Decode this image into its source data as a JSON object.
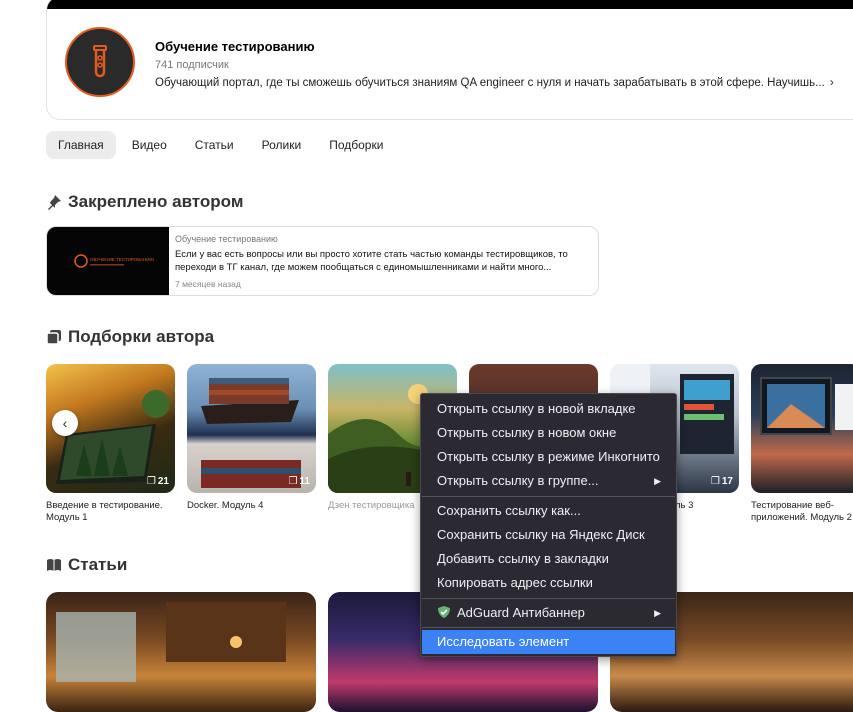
{
  "channel": {
    "title": "Обучение тестированию",
    "subscribers": "741 подписчик",
    "description": "Обучающий портал, где ты сможешь обучиться знаниям QA engineer с нуля и начать зарабатывать в этой сфере. Научишь...",
    "more_icon": "chevron-right-icon"
  },
  "tabs": [
    "Главная",
    "Видео",
    "Статьи",
    "Ролики",
    "Подборки"
  ],
  "pinned": {
    "section_title": "Закреплено автором",
    "author": "Обучение тестированию",
    "text": "Если у вас есть вопросы или вы просто хотите стать частью команды тестировщиков, то переходи в ТГ канал, где можем пообщаться с единомышленниками и найти много...",
    "time": "7 месяцев назад",
    "thumb_caption": "ОБУЧЕНИЕ ТЕСТИРОВАНИЮ"
  },
  "collections": {
    "section_title": "Подборки автора",
    "items": [
      {
        "label": "Введение в тестирование. Модуль 1",
        "count": "21"
      },
      {
        "label": "Docker. Модуль 4",
        "count": "11"
      },
      {
        "label": "Дзен тестировщика",
        "count": ""
      },
      {
        "label": "ль 3",
        "count": "17"
      },
      {
        "label": "",
        "count": "17"
      },
      {
        "label": "Тестирование веб-приложений. Модуль 2",
        "count": ""
      }
    ]
  },
  "articles": {
    "section_title": "Статьи"
  },
  "context_menu": {
    "items": [
      "Открыть ссылку в новой вкладке",
      "Открыть ссылку в новом окне",
      "Открыть ссылку в режиме Инкогнито",
      "Открыть ссылку в группе...",
      "Сохранить ссылку как...",
      "Сохранить ссылку на Яндекс Диск",
      "Добавить ссылку в закладки",
      "Копировать адрес ссылки",
      "AdGuard Антибаннер",
      "Исследовать элемент"
    ],
    "highlight_color": "#3b82f6"
  },
  "colors": {
    "accent": "#e35b1e",
    "menu_bg": "#2b2a33"
  }
}
